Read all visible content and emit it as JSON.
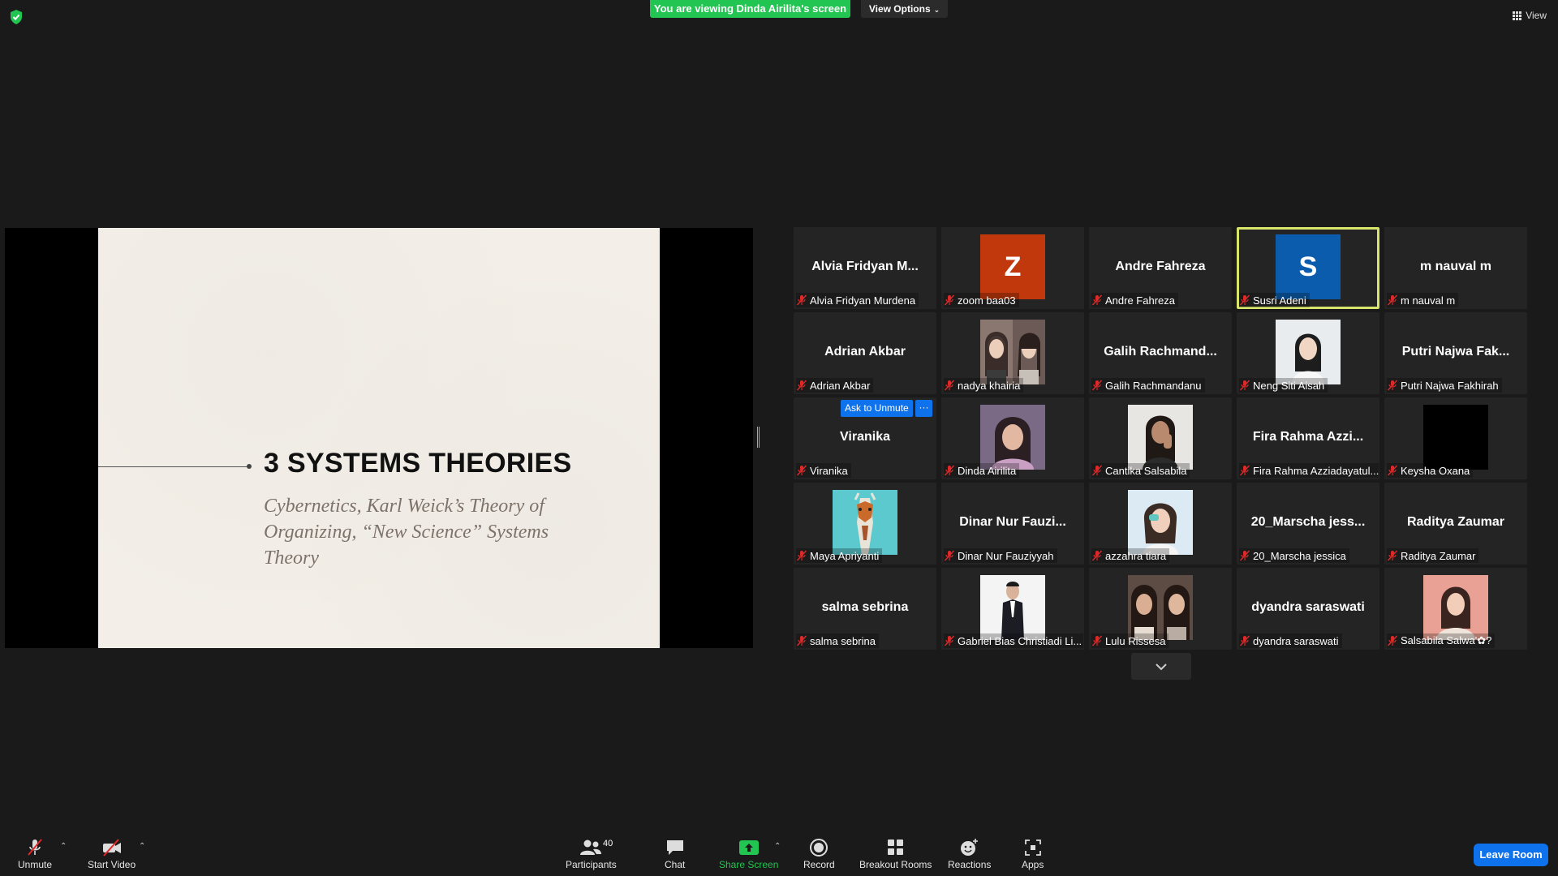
{
  "banner": {
    "viewing_text": "You are viewing Dinda Airilita's screen",
    "view_options_label": "View Options",
    "view_label": "View"
  },
  "slide": {
    "title": "3 SYSTEMS THEORIES",
    "subtitle": "Cybernetics, Karl Weick’s Theory of Organizing, “New Science” Systems Theory"
  },
  "participants": [
    {
      "big": "Alvia Fridyan M...",
      "label": "Alvia Fridyan Murdena"
    },
    {
      "letter": "Z",
      "color": "#c2380d",
      "label": "zoom baa03"
    },
    {
      "big": "Andre Fahreza",
      "label": "Andre Fahreza"
    },
    {
      "letter": "S",
      "color": "#0b5cad",
      "label": "Susri Adeni",
      "active": true
    },
    {
      "big": "m nauval m",
      "label": "m nauval m"
    },
    {
      "big": "Adrian Akbar",
      "label": "Adrian Akbar"
    },
    {
      "photo": "two-girls",
      "label": "nadya khairia"
    },
    {
      "big": "Galih  Rachmand...",
      "label": "Galih Rachmandanu"
    },
    {
      "photo": "girl-white",
      "label": "Neng Siti Aisah"
    },
    {
      "big": "Putri Najwa Fak...",
      "label": "Putri Najwa Fakhirah"
    },
    {
      "big": "Viranika",
      "label": "Viranika",
      "ask_unmute": "Ask to Unmute",
      "more": "···"
    },
    {
      "photo": "girl-purple",
      "label": "Dinda Airilita"
    },
    {
      "photo": "girl-hand",
      "label": "Cantika Salsabila"
    },
    {
      "big": "Fira Rahma Azzi...",
      "label": "Fira Rahma Azziadayatul..."
    },
    {
      "photo": "black",
      "label": "Keysha Oxana"
    },
    {
      "photo": "giraffe",
      "label": "Maya Apriyanti"
    },
    {
      "big": "Dinar Nur Fauzi...",
      "label": "Dinar Nur Fauziyyah"
    },
    {
      "photo": "girl-bright",
      "label": "azzahra tiara"
    },
    {
      "big": "20_Marscha  jess...",
      "label": "20_Marscha jessica"
    },
    {
      "big": "Raditya Zaumar",
      "label": "Raditya Zaumar"
    },
    {
      "big": "salma sebrina",
      "label": "salma sebrina"
    },
    {
      "photo": "man-suit",
      "label": "Gabriel Bias Christiadi Li..."
    },
    {
      "photo": "two-girls-2",
      "label": "Lulu Rissesa"
    },
    {
      "big": "dyandra saraswati",
      "label": "dyandra saraswati"
    },
    {
      "photo": "girl-pink",
      "label": "Salsabila Salwa'✿?"
    }
  ],
  "toolbar": {
    "unmute": "Unmute",
    "start_video": "Start Video",
    "participants": "Participants",
    "participants_count": "40",
    "chat": "Chat",
    "share_screen": "Share Screen",
    "record": "Record",
    "breakout_rooms": "Breakout Rooms",
    "reactions": "Reactions",
    "apps": "Apps",
    "leave": "Leave Room"
  },
  "colors": {
    "banner_green": "#23c552",
    "accent_blue": "#0e72ed",
    "active_speaker": "#d7e56a"
  }
}
